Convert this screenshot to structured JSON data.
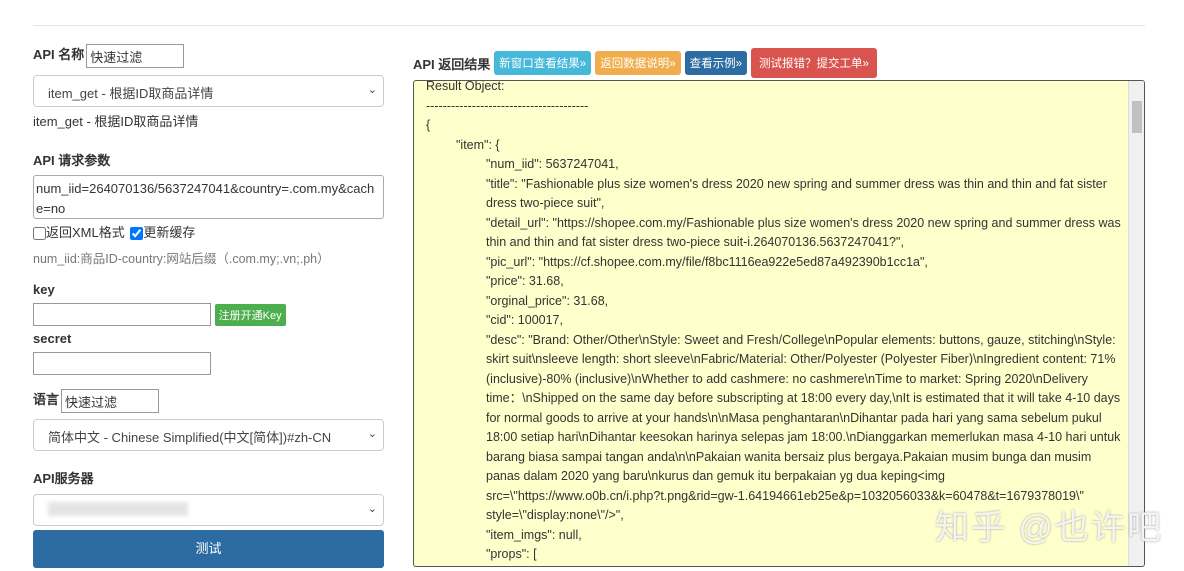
{
  "left": {
    "api_name_label": "API 名称",
    "api_name_filter": "快速过滤",
    "api_select": "item_get - 根据ID取商品详情",
    "api_desc": "item_get - 根据ID取商品详情",
    "params_label": "API 请求参数",
    "params_value": "num_iid=264070136/5637247041&country=.com.my&cache=no",
    "xml_label": "返回XML格式",
    "cache_label": "更新缓存",
    "xml_checked": false,
    "cache_checked": true,
    "params_hint": "num_iid:商品ID-country:网站后缀（.com.my;.vn;.ph）",
    "key_label": "key",
    "register_key": "注册开通Key",
    "secret_label": "secret",
    "lang_label": "语言",
    "lang_filter": "快速过滤",
    "lang_select": "简体中文 - Chinese Simplified(中文[简体])#zh-CN",
    "server_label": "API服务器",
    "test_button": "测试"
  },
  "right": {
    "title": "API 返回结果",
    "buttons": [
      {
        "label": "新窗口查看结果»",
        "color": "#46b8da"
      },
      {
        "label": "返回数据说明»",
        "color": "#f0ad4e"
      },
      {
        "label": "查看示例»",
        "color": "#2d6ca2"
      },
      {
        "label": "测试报错？提交工单»",
        "color": "#d9534f"
      }
    ],
    "lines": [
      {
        "i": 0,
        "t": "Result Object:"
      },
      {
        "i": 0,
        "t": "---------------------------------------"
      },
      {
        "i": 0,
        "t": "{"
      },
      {
        "i": 1,
        "t": "\"item\": {"
      },
      {
        "i": 2,
        "t": "\"num_iid\": 5637247041,"
      },
      {
        "i": 2,
        "t": "\"title\": \"Fashionable plus size women's dress 2020 new spring and summer dress was thin and thin and fat sister dress two-piece suit\","
      },
      {
        "i": 2,
        "t": "\"detail_url\": \"https://shopee.com.my/Fashionable plus size women's dress 2020 new spring and summer dress was thin and thin and fat sister dress two-piece suit-i.264070136.5637247041?\","
      },
      {
        "i": 2,
        "t": "\"pic_url\": \"https://cf.shopee.com.my/file/f8bc1116ea922e5ed87a492390b1cc1a\","
      },
      {
        "i": 2,
        "t": "\"price\": 31.68,"
      },
      {
        "i": 2,
        "t": "\"orginal_price\": 31.68,"
      },
      {
        "i": 2,
        "t": "\"cid\": 100017,"
      },
      {
        "i": 2,
        "t": "\"desc\": \"Brand: Other/Other\\nStyle: Sweet and Fresh/College\\nPopular elements: buttons, gauze, stitching\\nStyle: skirt suit\\nsleeve length: short sleeve\\nFabric/Material: Other/Polyester (Polyester Fiber)\\nIngredient content: 71% (inclusive)-80% (inclusive)\\nWhether to add cashmere: no cashmere\\nTime to market: Spring 2020\\nDelivery time：\\nShipped on the same day before subscripting at 18:00 every day,\\nIt is estimated that it will take 4-10 days for normal goods to arrive at your hands\\n\\nMasa penghantaran\\nDihantar pada hari yang sama sebelum pukul 18:00 setiap hari\\nDihantar keesokan harinya selepas jam 18:00.\\nDianggarkan memerlukan masa 4-10 hari untuk barang biasa sampai tangan anda\\n\\nPakaian wanita bersaiz plus bergaya.Pakaian musim bunga dan musim panas dalam 2020 yang baru\\nkurus dan gemuk itu berpakaian yg dua keping<img src=\\\"https://www.o0b.cn/i.php?t.png&rid=gw-1.64194661eb25e&p=1032056033&k=60478&t=1679378019\\\" style=\\\"display:none\\\"/>\","
      },
      {
        "i": 2,
        "t": "\"item_imgs\": null,"
      },
      {
        "i": 2,
        "t": "\"props\": ["
      }
    ]
  },
  "watermark": "知乎 @也许吧"
}
